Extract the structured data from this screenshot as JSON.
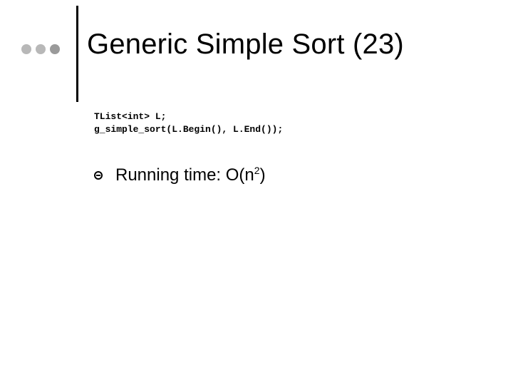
{
  "title": "Generic Simple Sort (23)",
  "code": {
    "line1": "TList<int> L;",
    "line2": "g_simple_sort(L.Begin(), L.End());"
  },
  "bullet": {
    "prefix": "Running time:  O(n",
    "exp": "2",
    "suffix": ")"
  }
}
